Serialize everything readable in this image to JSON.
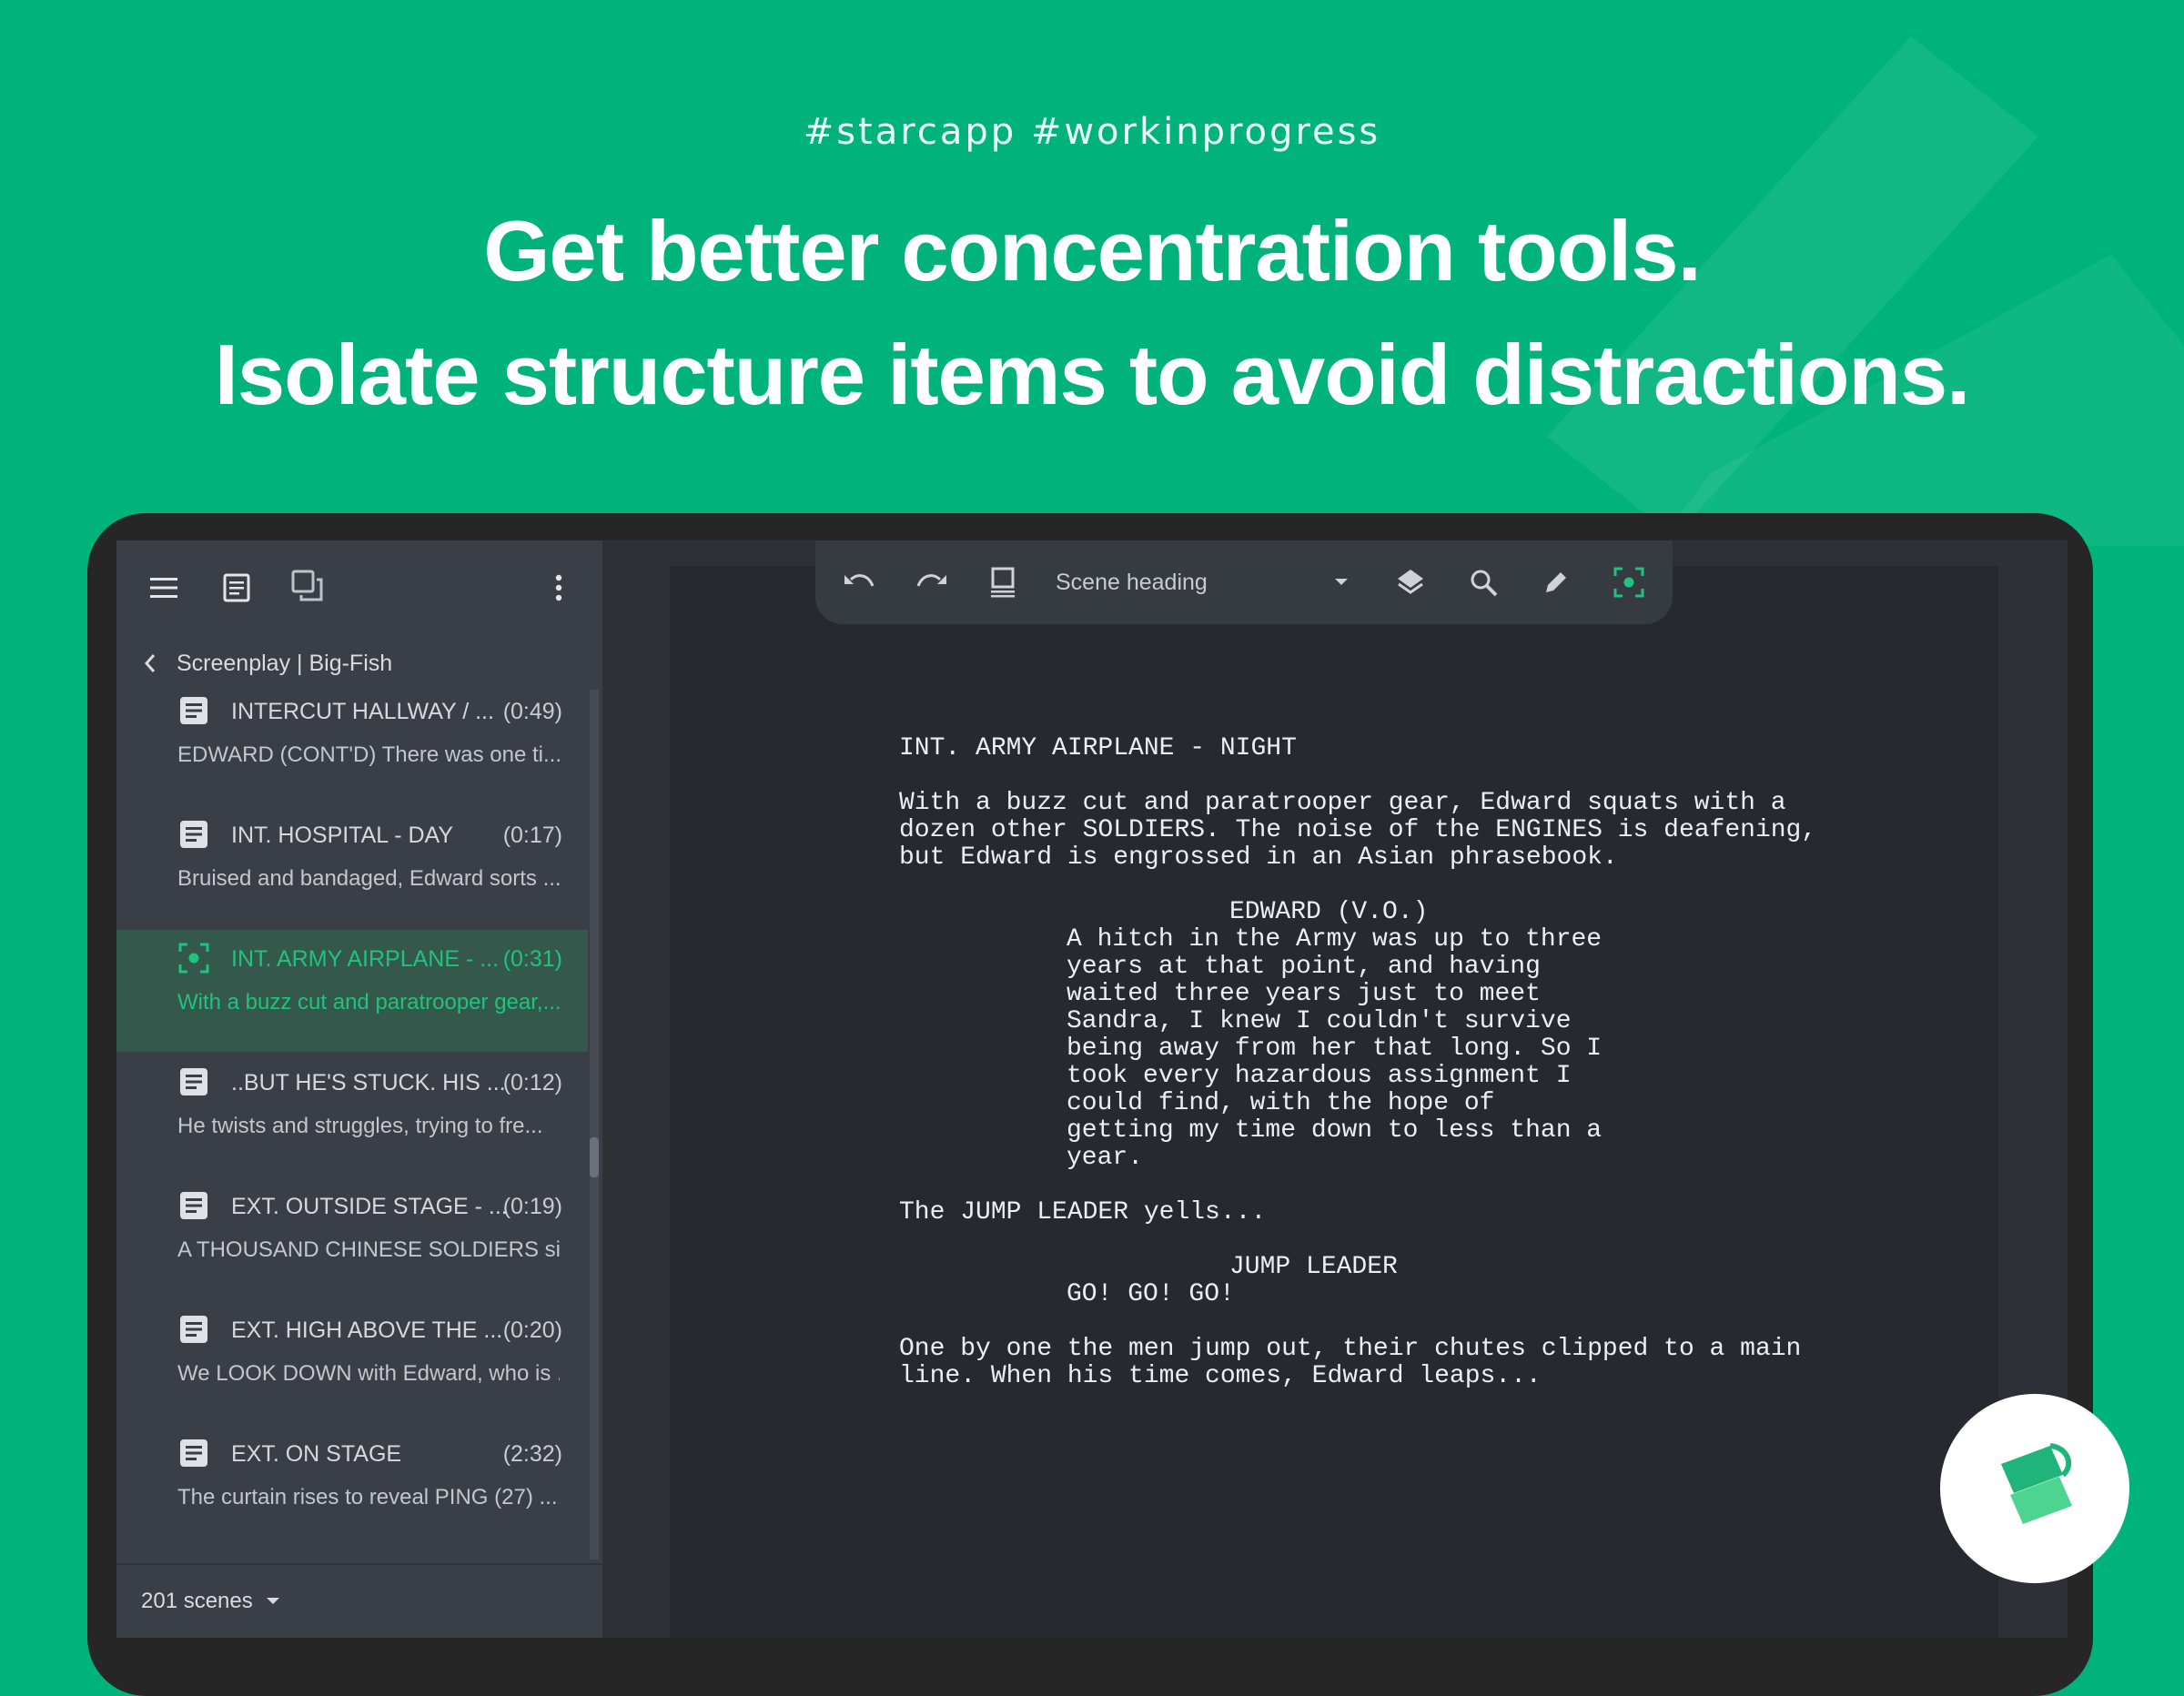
{
  "colors": {
    "brand_green": "#00b37a",
    "active_green": "#20c37e",
    "panel_dark": "#3a3f47",
    "page_dark": "#262930"
  },
  "hero": {
    "hashtags": "#starcapp  #workinprogress",
    "headline_line1": "Get better concentration tools.",
    "headline_line2": "Isolate structure items to avoid distractions."
  },
  "sidebar": {
    "top_icons": [
      "menu-icon",
      "document-icon",
      "copy-icon",
      "more-vert-icon"
    ],
    "breadcrumb": "Screenplay | Big-Fish",
    "scenes": [
      {
        "title": "INTERCUT HALLWAY / ...",
        "duration": "(0:49)",
        "text": "EDWARD (CONT'D) There was one ti...",
        "icon": "scene-text-icon",
        "active": false
      },
      {
        "title": "INT. HOSPITAL - DAY",
        "duration": "(0:17)",
        "text": "Bruised and bandaged, Edward sorts ...",
        "icon": "scene-text-icon",
        "active": false
      },
      {
        "title": "INT. ARMY AIRPLANE - ...",
        "duration": "(0:31)",
        "text": "With a buzz cut and paratrooper gear,...",
        "icon": "focus-icon",
        "active": true
      },
      {
        "title": "..BUT HE'S STUCK. HIS ...",
        "duration": "(0:12)",
        "text": "He twists and struggles, trying to fre...",
        "icon": "scene-text-icon",
        "active": false
      },
      {
        "title": "EXT. OUTSIDE STAGE - ...",
        "duration": "(0:19)",
        "text": "A THOUSAND CHINESE SOLDIERS sit...",
        "icon": "scene-text-icon",
        "active": false
      },
      {
        "title": "EXT. HIGH ABOVE THE ...",
        "duration": "(0:20)",
        "text": "We LOOK DOWN with Edward, who is ...",
        "icon": "scene-text-icon",
        "active": false
      },
      {
        "title": "EXT. ON STAGE",
        "duration": "(2:32)",
        "text": "The curtain rises to reveal PING (27) ...",
        "icon": "scene-text-icon",
        "active": false
      }
    ],
    "scene_count": "201 scenes"
  },
  "toolbar": {
    "icons": [
      "undo-icon",
      "redo-icon",
      "fast-format-icon",
      "layers-icon",
      "search-icon",
      "pen-icon",
      "focus-icon"
    ],
    "block_type": "Scene heading"
  },
  "script": {
    "scene_heading": "INT. ARMY AIRPLANE - NIGHT",
    "action1": "With a buzz cut and paratrooper gear, Edward squats with a\ndozen other SOLDIERS. The noise of the ENGINES is deafening,\nbut Edward is engrossed in an Asian phrasebook.",
    "character1": "EDWARD (V.O.)",
    "dialogue1": "A hitch in the Army was up to three\nyears at that point, and having\nwaited three years just to meet\nSandra, I knew I couldn't survive\nbeing away from her that long. So I\ntook every hazardous assignment I\ncould find, with the hope of\ngetting my time down to less than a\nyear.",
    "action2": "The JUMP LEADER yells...",
    "character2": "JUMP LEADER",
    "dialogue2": "GO! GO! GO!",
    "action3": "One by one the men jump out, their chutes clipped to a main\nline. When his time comes, Edward leaps..."
  }
}
